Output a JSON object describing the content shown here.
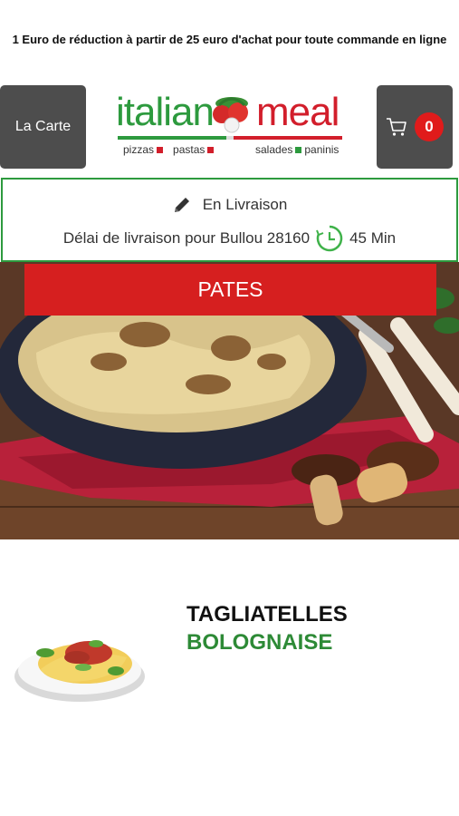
{
  "promo": {
    "text": "1 Euro de réduction à partir de 25 euro d'achat pour toute commande en ligne"
  },
  "header": {
    "menu_label": "La Carte",
    "logo": {
      "left": "italian",
      "right": "meal",
      "tag_pizzas": "pizzas",
      "tag_pastas": "pastas",
      "tag_salades": "salades",
      "tag_paninis": "paninis"
    },
    "cart": {
      "icon": "cart-icon",
      "count": "0"
    }
  },
  "delivery": {
    "mode": "En Livraison",
    "mode_icon": "pencil-icon",
    "delay_label": "Délai de livraison pour Bullou 28160",
    "delay_icon": "clock-icon",
    "delay_value": "45 Min"
  },
  "category": {
    "title": "PATES"
  },
  "product": {
    "title_line1": "TAGLIATELLES",
    "title_line2": "BOLOGNAISE"
  },
  "colors": {
    "green": "#2d9a3e",
    "red": "#d61f1f",
    "dark_button": "#4d4d4d"
  }
}
